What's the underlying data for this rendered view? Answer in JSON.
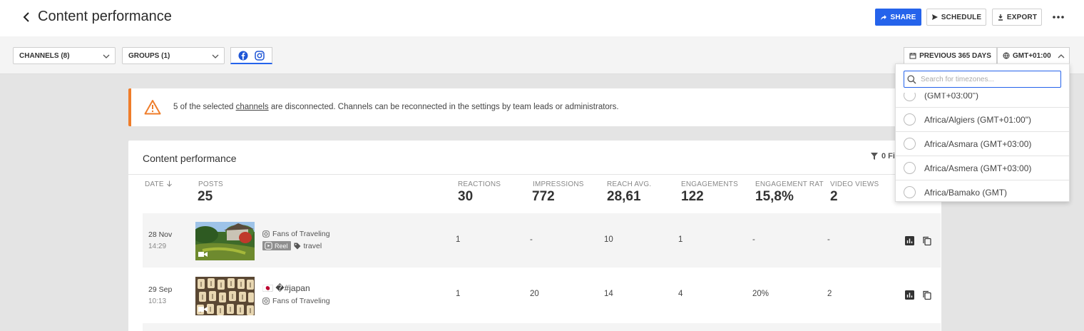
{
  "header": {
    "title": "Content performance",
    "share_label": "SHARE",
    "schedule_label": "SCHEDULE",
    "export_label": "EXPORT"
  },
  "filters": {
    "channels_label": "CHANNELS (8)",
    "groups_label": "GROUPS (1)",
    "date_range_label": "PREVIOUS 365 DAYS",
    "timezone_label": "GMT+01:00"
  },
  "timezone_dropdown": {
    "search_placeholder": "Search for timezones...",
    "items": [
      {
        "label": "(GMT+03:00\")"
      },
      {
        "label": "Africa/Algiers (GMT+01:00\")"
      },
      {
        "label": "Africa/Asmara (GMT+03:00)"
      },
      {
        "label": "Africa/Asmera (GMT+03:00)"
      },
      {
        "label": "Africa/Bamako (GMT)"
      }
    ]
  },
  "warning": {
    "text_before": "5 of the selected ",
    "link": "channels",
    "text_after": " are disconnected. Channels can be reconnected in the settings by team leads or administrators."
  },
  "card": {
    "title": "Content performance",
    "filter_label": "0 Fi"
  },
  "table": {
    "columns": [
      {
        "header": "DATE",
        "total": ""
      },
      {
        "header": "POSTS",
        "total": "25"
      },
      {
        "header": "REACTIONS",
        "total": "30"
      },
      {
        "header": "IMPRESSIONS",
        "total": "772"
      },
      {
        "header": "REACH AVG.",
        "total": "28,61"
      },
      {
        "header": "ENGAGEMENTS",
        "total": "122"
      },
      {
        "header": "ENGAGEMENT RAT",
        "total": "15,8%"
      },
      {
        "header": "VIDEO VIEWS",
        "total": "2"
      }
    ],
    "rows": [
      {
        "date": "28 Nov",
        "time": "14:29",
        "channel": "Fans of Traveling",
        "badge": "Reel",
        "tag": "travel",
        "reactions": "1",
        "impressions": "-",
        "reach": "10",
        "engagements": "1",
        "engagement_rate": "-",
        "video_views": "-"
      },
      {
        "date": "29 Sep",
        "time": "10:13",
        "caption": "🇯🇵 �#japan",
        "channel": "Fans of Traveling",
        "reactions": "1",
        "impressions": "20",
        "reach": "14",
        "engagements": "4",
        "engagement_rate": "20%",
        "video_views": "2"
      }
    ]
  },
  "colors": {
    "accent": "#2563eb",
    "warning": "#ef7d2a"
  }
}
